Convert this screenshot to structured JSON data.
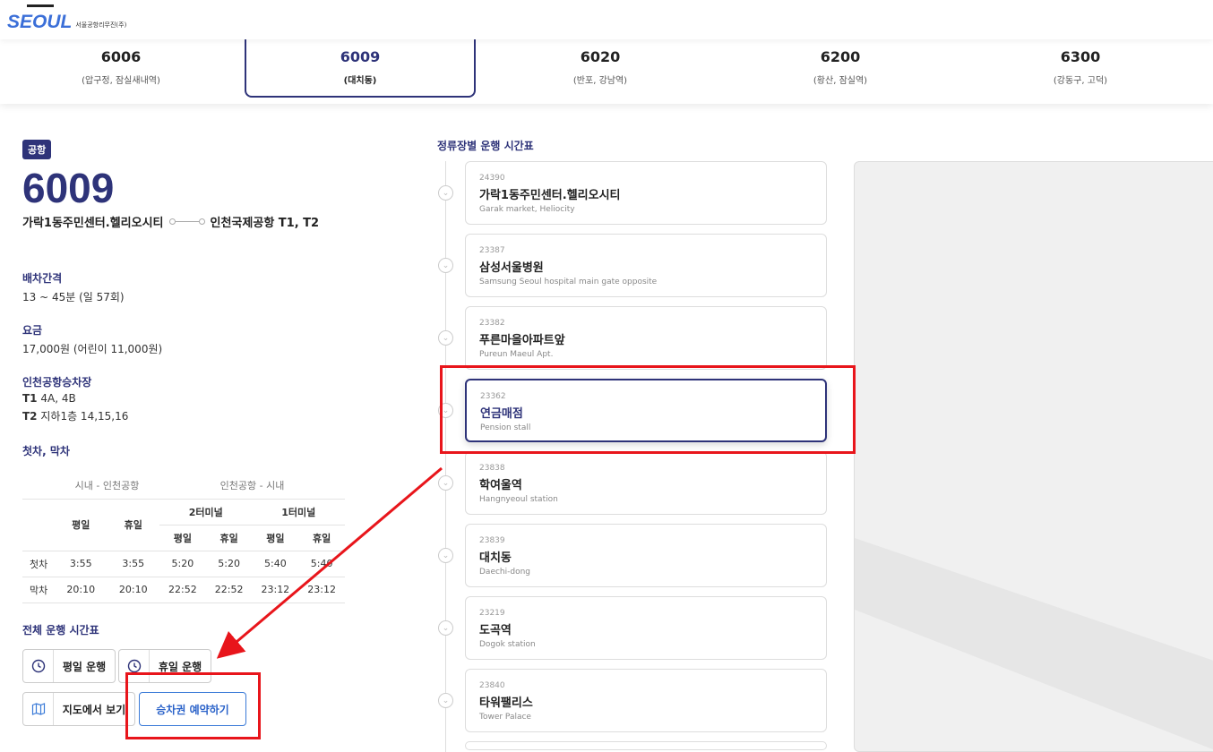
{
  "logo": {
    "word": "SEOUL",
    "sub": "서울공항리무진(주)"
  },
  "tabs": [
    {
      "num": "6006",
      "desc": "(압구정, 잠실새내역)"
    },
    {
      "num": "6009",
      "desc": "(대치동)"
    },
    {
      "num": "6020",
      "desc": "(반포, 강남역)"
    },
    {
      "num": "6200",
      "desc": "(황산, 잠실역)"
    },
    {
      "num": "6300",
      "desc": "(강동구, 고덕)"
    }
  ],
  "route": {
    "badge": "공항",
    "number": "6009",
    "from": "가락1동주민센터.헬리오시티",
    "to": "인천국제공항 T1, T2"
  },
  "info": {
    "interval_label": "배차간격",
    "interval_val": "13 ~ 45분 (일 57회)",
    "fare_label": "요금",
    "fare_val": "17,000원 (어린이 11,000원)",
    "stop_label": "인천공항승차장",
    "t1": "T1",
    "t1_val": " 4A, 4B",
    "t2": "T2",
    "t2_val": " 지하1층 14,15,16",
    "firstlast_label": "첫차, 막차"
  },
  "table": {
    "h_city_airport": "시내 - 인천공항",
    "h_airport_city": "인천공항 - 시내",
    "h_weekday": "평일",
    "h_holiday": "휴일",
    "h_t2": "2터미널",
    "h_t1": "1터미널",
    "rows": [
      {
        "label": "첫차",
        "vals": [
          "3:55",
          "3:55",
          "5:20",
          "5:20",
          "5:40",
          "5:40"
        ]
      },
      {
        "label": "막차",
        "vals": [
          "20:10",
          "20:10",
          "22:52",
          "22:52",
          "23:12",
          "23:12"
        ]
      }
    ]
  },
  "full_schedule_label": "전체 운행 시간표",
  "buttons": {
    "weekday": "평일 운행",
    "holiday": "휴일 운행",
    "map": "지도에서 보기",
    "reserve": "승차권 예약하기"
  },
  "timeline_title": "정류장별 운행 시간표",
  "stops": [
    {
      "id": "24390",
      "name": "가락1동주민센터.헬리오시티",
      "en": "Garak market, Heliocity"
    },
    {
      "id": "23387",
      "name": "삼성서울병원",
      "en": "Samsung Seoul hospital main gate opposite"
    },
    {
      "id": "23382",
      "name": "푸른마을아파트앞",
      "en": "Pureun Maeul Apt."
    },
    {
      "id": "23362",
      "name": "연금매점",
      "en": "Pension stall"
    },
    {
      "id": "23838",
      "name": "학여울역",
      "en": "Hangnyeoul station"
    },
    {
      "id": "23839",
      "name": "대치동",
      "en": "Daechi-dong"
    },
    {
      "id": "23219",
      "name": "도곡역",
      "en": "Dogok station"
    },
    {
      "id": "23840",
      "name": "타워팰리스",
      "en": "Tower Palace"
    }
  ]
}
